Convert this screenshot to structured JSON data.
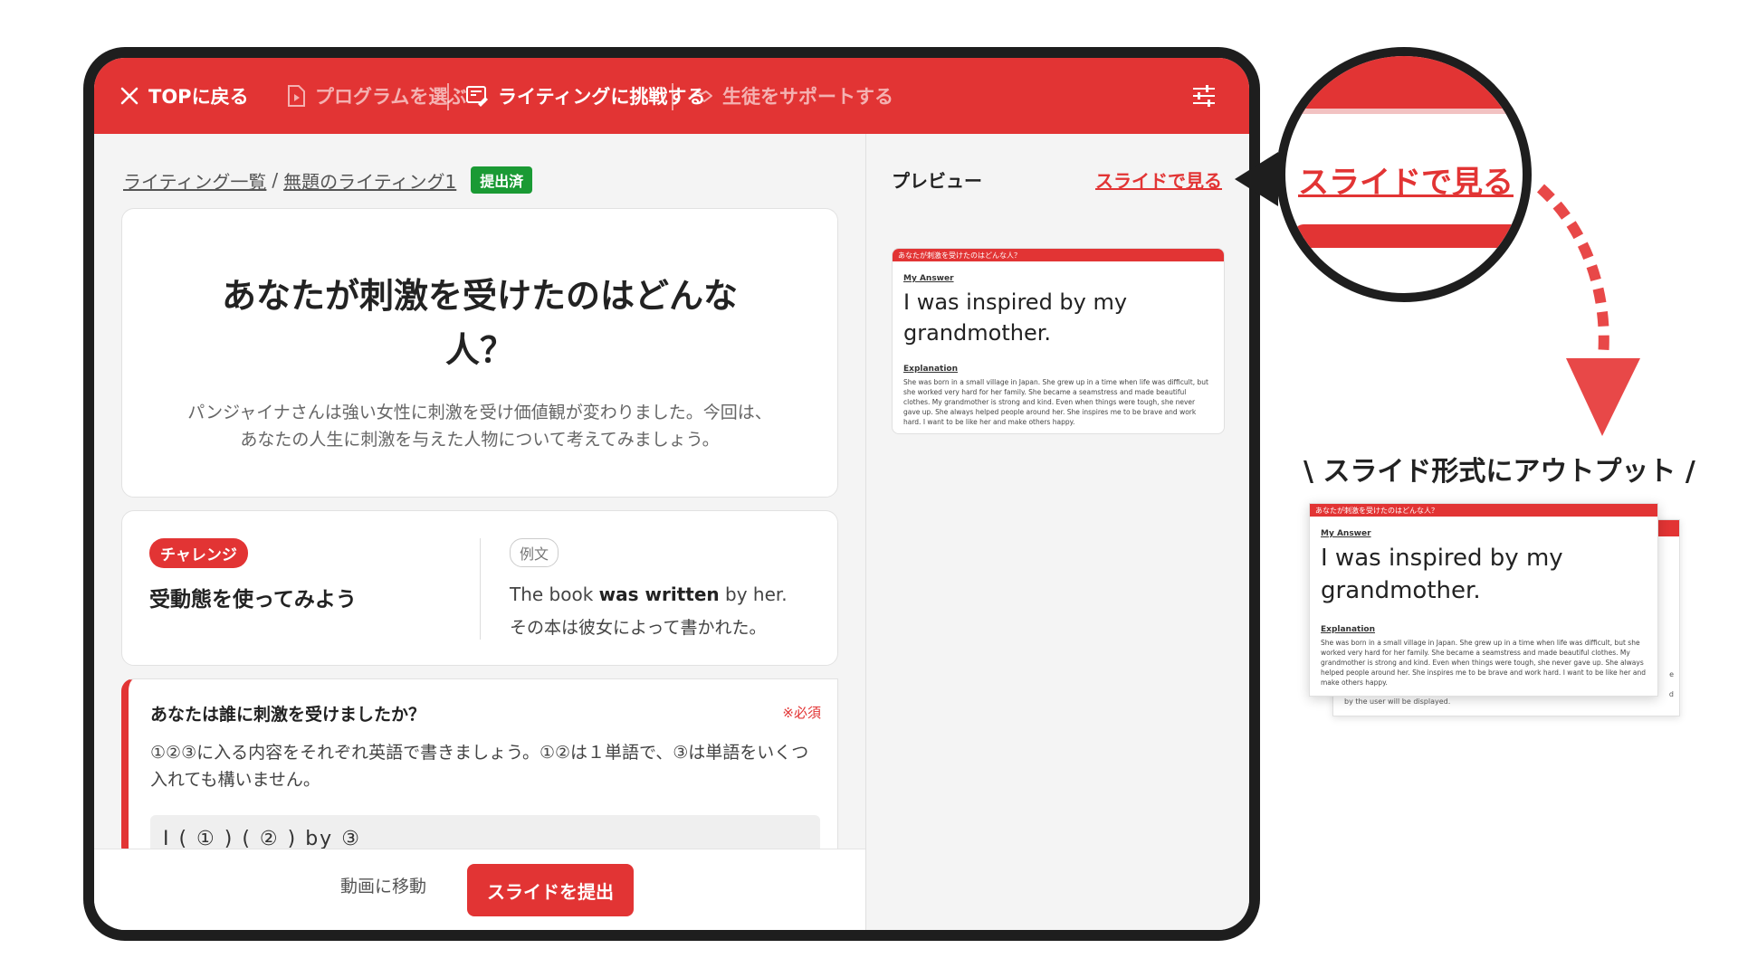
{
  "header": {
    "back_label": "TOPに戻る",
    "nav": [
      "プログラムを選ぶ",
      "ライティングに挑戦する",
      "生徒をサポートする"
    ]
  },
  "breadcrumb": {
    "list_link": "ライティング一覧",
    "separator": "/",
    "current": "無題のライティング1",
    "status_badge": "提出済"
  },
  "question": {
    "title": "あなたが刺激を受けたのはどんな人？",
    "description": "パンジャイナさんは強い女性に刺激を受け価値観が変わりました。今回は、あなたの人生に刺激を与えた人物について考えてみましょう。"
  },
  "challenge": {
    "badge": "チャレンジ",
    "text": "受動態を使ってみよう",
    "example_badge": "例文",
    "example_en_prefix": "The book ",
    "example_en_bold": "was written",
    "example_en_suffix": " by her.",
    "example_ja": "その本は彼女によって書かれた。"
  },
  "prompt": {
    "title": "あなたは誰に刺激を受けましたか？",
    "required": "※必須",
    "description": "①②③に入る内容をそれぞれ英語で書きましょう。①②は１単語で、③は単語をいくつ入れても構いません。",
    "template_preview": "I ( ① ) ( ② ) by   ③"
  },
  "footer": {
    "move_label": "動画に移動",
    "submit_label": "スライドを提出"
  },
  "preview": {
    "label": "プレビュー",
    "view_slide_link": "スライドで見る",
    "slide": {
      "header": "あなたが刺激を受けたのはどんな人？",
      "answer_label": "My Answer",
      "answer": "I was inspired by my grandmother.",
      "explanation_label": "Explanation",
      "explanation": "She was born in a small village in Japan. She grew up in a time when life was difficult, but she worked very hard for her family. She became a seamstress and made beautiful clothes. My grandmother is strong and kind. Even when things were tough, she never gave up. She always helped people around her. She inspires me to be brave and work hard. I want to be like her and make others happy."
    }
  },
  "callout": {
    "zoom_text": "スライドで見る",
    "caption": "\\ スライド形式にアウトプット /",
    "back_slide_footer": "by the user will be displayed.",
    "back_slide_edge_1": "e",
    "back_slide_edge_2": "d"
  },
  "colors": {
    "accent": "#e23434",
    "success": "#1a9a34",
    "frame": "#1e1e1e"
  }
}
